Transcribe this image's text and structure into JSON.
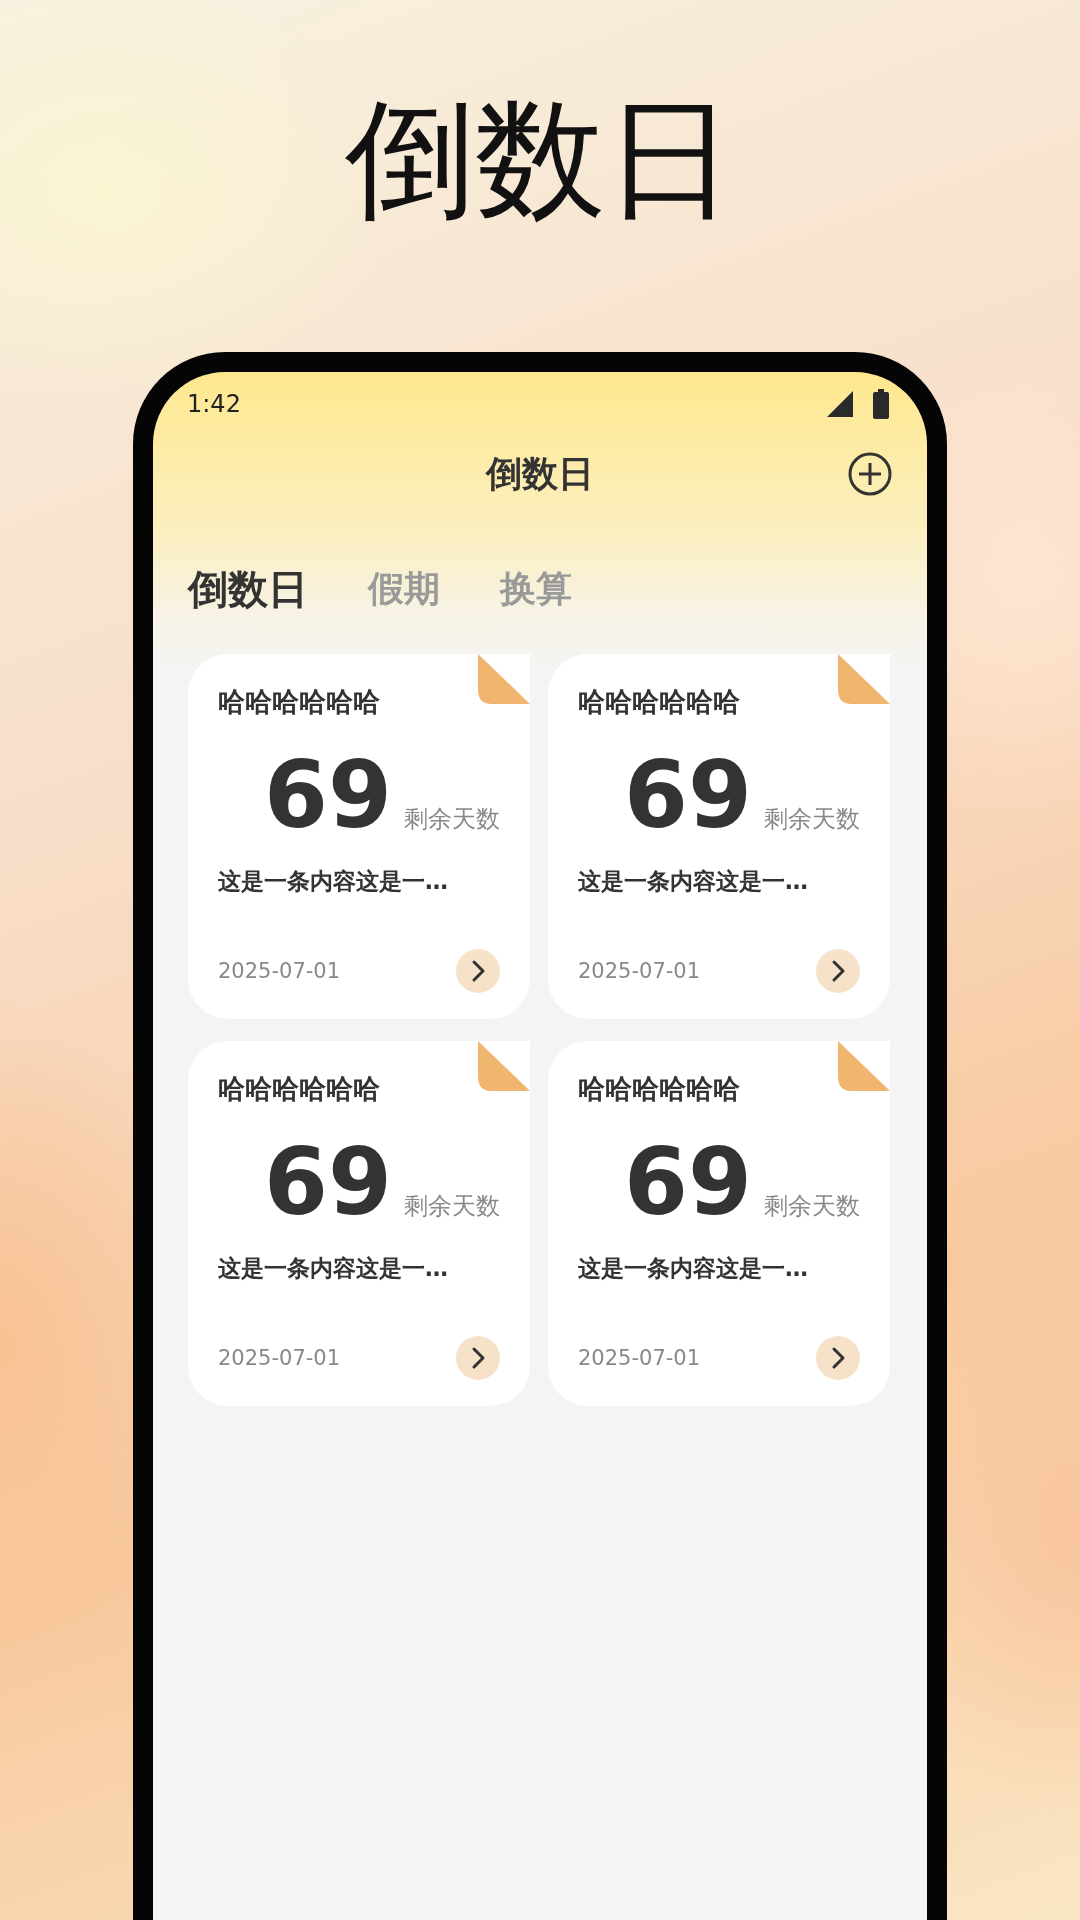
{
  "headline": "倒数日",
  "status_bar": {
    "time": "1:42"
  },
  "app_bar": {
    "title": "倒数日"
  },
  "tabs": [
    {
      "label": "倒数日",
      "selected": true
    },
    {
      "label": "假期",
      "selected": false
    },
    {
      "label": "换算",
      "selected": false
    }
  ],
  "cards": [
    {
      "title": "哈哈哈哈哈哈",
      "days": "69",
      "days_label": "剩余天数",
      "description": "这是一条内容这是一…",
      "date": "2025-07-01"
    },
    {
      "title": "哈哈哈哈哈哈",
      "days": "69",
      "days_label": "剩余天数",
      "description": "这是一条内容这是一…",
      "date": "2025-07-01"
    },
    {
      "title": "哈哈哈哈哈哈",
      "days": "69",
      "days_label": "剩余天数",
      "description": "这是一条内容这是一…",
      "date": "2025-07-01"
    },
    {
      "title": "哈哈哈哈哈哈",
      "days": "69",
      "days_label": "剩余天数",
      "description": "这是一条内容这是一…",
      "date": "2025-07-01"
    }
  ]
}
